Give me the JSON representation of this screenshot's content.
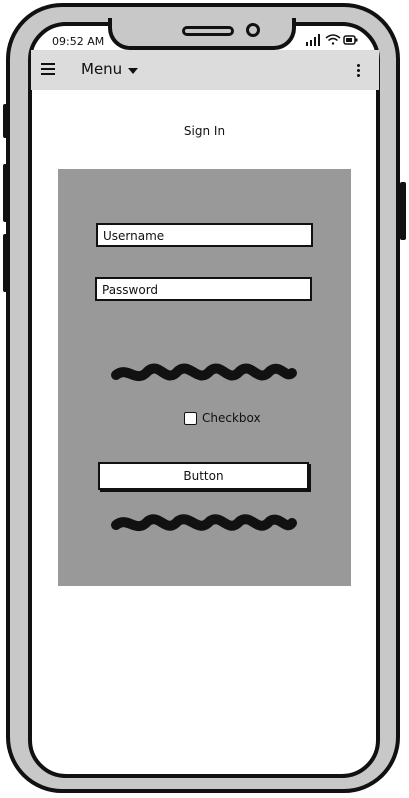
{
  "status_bar": {
    "time": "09:52 AM",
    "icons": [
      "signal-icon",
      "wifi-icon",
      "battery-icon"
    ]
  },
  "app_bar": {
    "title": "Menu",
    "left_icon": "hamburger-icon",
    "dropdown_icon": "chevron-down-icon",
    "right_icon": "more-vert-icon"
  },
  "page": {
    "title": "Sign In"
  },
  "form": {
    "username_value": "Username",
    "password_value": "Password",
    "checkbox_label": "Checkbox",
    "checkbox_checked": false,
    "button_label": "Button"
  },
  "colors": {
    "panel_bg": "#999999",
    "appbar_bg": "#dcdcdc",
    "frame": "#c8c8c8",
    "ink": "#111111"
  }
}
